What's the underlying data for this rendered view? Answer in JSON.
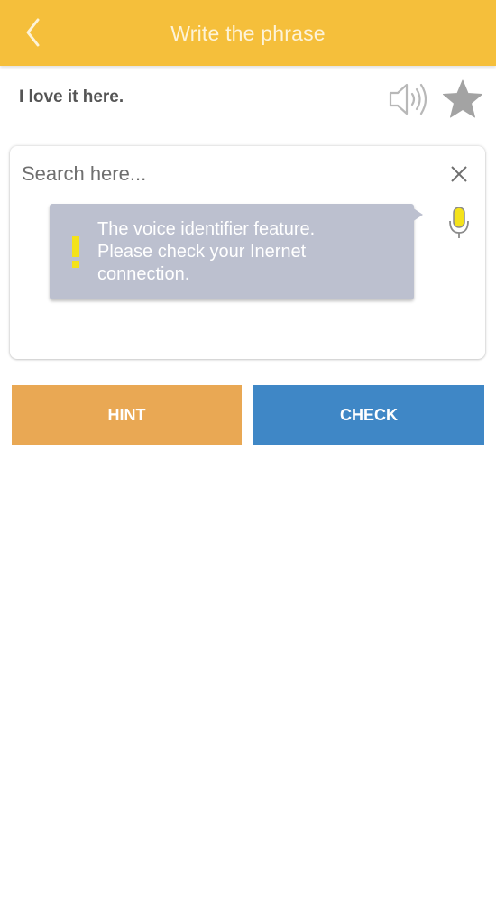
{
  "header": {
    "title": "Write the phrase",
    "back_icon": "chevron-left-icon",
    "background": "#f5bf3b"
  },
  "phrase": {
    "text": "I love it here.",
    "speaker_icon": "speaker-icon",
    "favorite_icon": "star-icon"
  },
  "search": {
    "placeholder": "Search here...",
    "value": "",
    "clear_icon": "close-icon",
    "mic_icon": "microphone-icon"
  },
  "tooltip": {
    "icon": "exclamation-icon",
    "lines": [
      "The voice identifier feature.",
      "Please check your Inernet",
      "connection."
    ]
  },
  "actions": {
    "hint_label": "HINT",
    "check_label": "CHECK",
    "hint_color": "#e9a854",
    "check_color": "#3f87c6"
  }
}
